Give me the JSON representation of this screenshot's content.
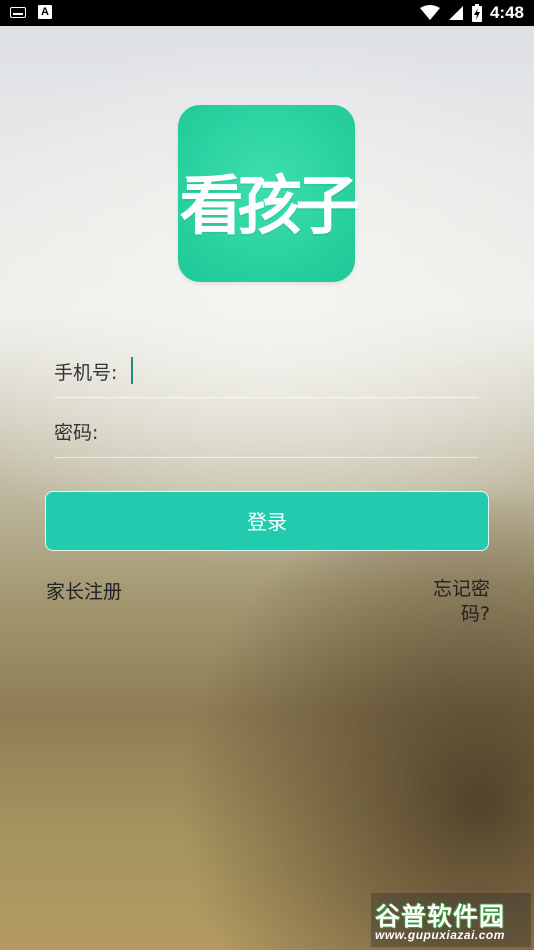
{
  "status_bar": {
    "time": "4:48",
    "left_icons": [
      "keyboard-icon",
      "text-a-icon"
    ],
    "right_icons": [
      "wifi-icon",
      "signal-icon",
      "battery-charging-icon"
    ]
  },
  "logo": {
    "text": "看孩子",
    "color": "#24d39f"
  },
  "form": {
    "phone_label": "手机号:",
    "phone_value": "",
    "password_label": "密码:",
    "password_value": ""
  },
  "login_button": {
    "label": "登录",
    "color": "#22cbae"
  },
  "links": {
    "register": "家长注册",
    "forgot_line1": "忘记密",
    "forgot_line2": "码?"
  },
  "watermark": {
    "name": "谷普软件园",
    "url": "www.gupuxiazai.com"
  }
}
